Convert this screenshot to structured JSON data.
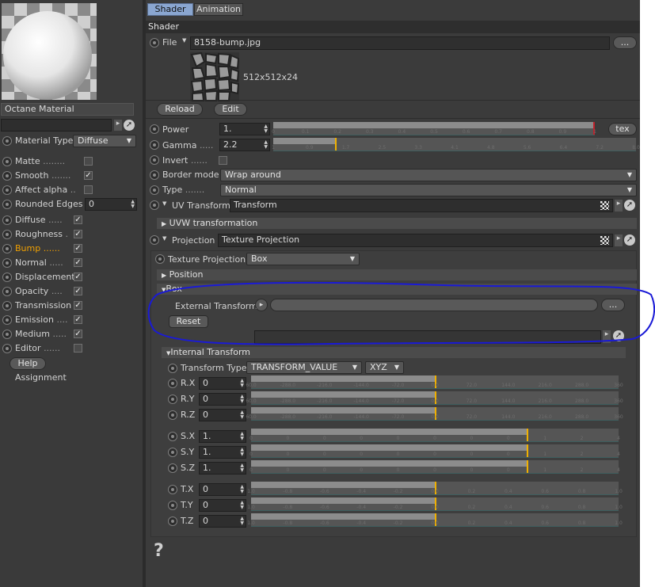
{
  "left": {
    "material_name": "Octane Material",
    "material_type_label": "Material Type",
    "material_type_value": "Diffuse",
    "channels": [
      {
        "label": "Matte",
        "dots": "........",
        "checked": false,
        "active": false
      },
      {
        "label": "Smooth",
        "dots": ".......",
        "checked": true,
        "active": false
      },
      {
        "label": "Affect alpha",
        "dots": "..",
        "checked": false,
        "active": false
      },
      {
        "label": "Rounded Edges",
        "dots": "",
        "checked": null,
        "active": false,
        "value": "0"
      },
      {
        "label": "Diffuse",
        "dots": ".....",
        "checked": true,
        "active": false
      },
      {
        "label": "Roughness",
        "dots": ".",
        "checked": true,
        "active": false
      },
      {
        "label": "Bump",
        "dots": "......",
        "checked": true,
        "active": true
      },
      {
        "label": "Normal",
        "dots": ".....",
        "checked": true,
        "active": false
      },
      {
        "label": "Displacement",
        "dots": "",
        "checked": true,
        "active": false
      },
      {
        "label": "Opacity",
        "dots": "....",
        "checked": true,
        "active": false
      },
      {
        "label": "Transmission",
        "dots": "",
        "checked": true,
        "active": false
      },
      {
        "label": "Emission",
        "dots": "....",
        "checked": true,
        "active": false
      },
      {
        "label": "Medium",
        "dots": ".....",
        "checked": true,
        "active": false
      },
      {
        "label": "Editor",
        "dots": "......",
        "checked": false,
        "active": false
      }
    ],
    "help_label": "Help",
    "assignment_label": "Assignment"
  },
  "tabs": [
    "Shader",
    "Animation"
  ],
  "section_title": "Shader",
  "file": {
    "label": "File",
    "value": "8158-bump.jpg",
    "browse": "...",
    "resolution": "512x512x24"
  },
  "reload_label": "Reload",
  "edit_label": "Edit",
  "power": {
    "label": "Power",
    "value": "1.",
    "ticks": [
      "0",
      "0.1",
      "0.2",
      "0.3",
      "0.4",
      "0.5",
      "0.6",
      "0.7",
      "0.8",
      "0.9",
      "1"
    ],
    "fill": 1.0,
    "tex_label": "tex"
  },
  "gamma": {
    "label": "Gamma",
    "dots": ".....",
    "value": "2.2",
    "ticks": [
      "1",
      "0.9",
      "1.7",
      "2.5",
      "3.3",
      "4.1",
      "4.8",
      "5.6",
      "6.4",
      "7.2",
      "8.0"
    ],
    "fill": 0.17
  },
  "invert": {
    "label": "Invert",
    "dots": "......"
  },
  "border_mode": {
    "label": "Border mode",
    "value": "Wrap around"
  },
  "type": {
    "label": "Type",
    "dots": ".......",
    "value": "Normal"
  },
  "uv_transform": {
    "label": "UV Transform",
    "value": "Transform"
  },
  "uvw_header": "UVW transformation",
  "projection": {
    "label": "Projection",
    "value": "Texture Projection"
  },
  "texture_projection": {
    "label": "Texture Projection",
    "value": "Box"
  },
  "position_header": "Position",
  "box_header": "Box",
  "external_transform_label": "External Transform",
  "reset_label": "Reset",
  "internal_header": "Internal Transform",
  "transform_type": {
    "label": "Transform Type",
    "value": "TRANSFORM_VALUE",
    "order": "XYZ"
  },
  "rot_ticks": [
    "60.0",
    "-288.0",
    "-216.0",
    "-144.0",
    "-72.0",
    "0.0",
    "72.0",
    "144.0",
    "216.0",
    "288.0",
    "360"
  ],
  "scale_ticks": [
    "0",
    "0",
    "0",
    "0",
    "0",
    "0",
    "0",
    "0",
    "1",
    "2",
    "4"
  ],
  "trans_ticks": [
    "1.0",
    "-0.8",
    "-0.6",
    "-0.4",
    "-0.2",
    "0.0",
    "0.2",
    "0.4",
    "0.6",
    "0.8",
    "1.0"
  ],
  "rows": [
    {
      "label": "R.X",
      "value": "0",
      "group": "rot",
      "fill": 0.5
    },
    {
      "label": "R.Y",
      "value": "0",
      "group": "rot",
      "fill": 0.5
    },
    {
      "label": "R.Z",
      "value": "0",
      "group": "rot",
      "fill": 0.5
    },
    {
      "label": "S.X",
      "value": "1.",
      "group": "scale",
      "fill": 0.75
    },
    {
      "label": "S.Y",
      "value": "1.",
      "group": "scale",
      "fill": 0.75
    },
    {
      "label": "S.Z",
      "value": "1.",
      "group": "scale",
      "fill": 0.75
    },
    {
      "label": "T.X",
      "value": "0",
      "group": "trans",
      "fill": 0.5
    },
    {
      "label": "T.Y",
      "value": "0",
      "group": "trans",
      "fill": 0.5
    },
    {
      "label": "T.Z",
      "value": "0",
      "group": "trans",
      "fill": 0.5
    }
  ],
  "help_icon": "?",
  "colors": {
    "annotation": "#1a1ad6",
    "accent_active": "#f0b000",
    "tab_active": "#8aa6d0"
  }
}
